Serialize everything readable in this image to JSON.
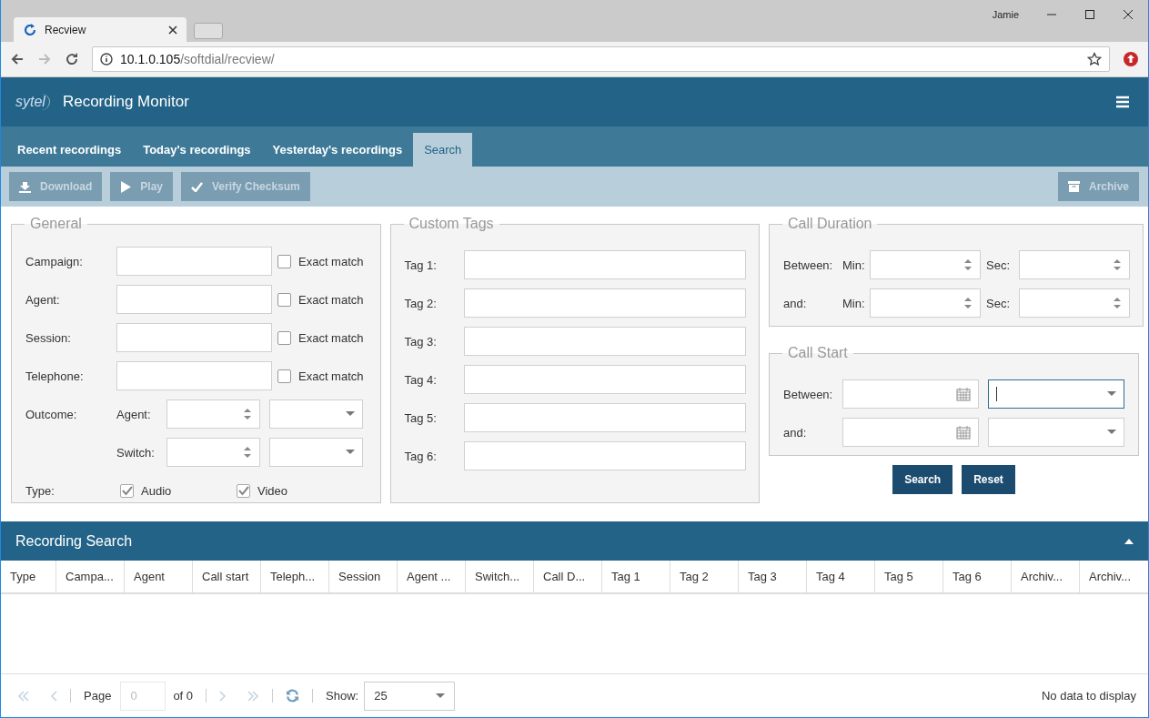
{
  "browser": {
    "tab_title": "Recview",
    "user": "Jamie",
    "url_host": "10.1.0.105",
    "url_path": "/softdial/recview/"
  },
  "header": {
    "logo": "sytel",
    "title": "Recording Monitor"
  },
  "tabs": [
    {
      "label": "Recent recordings",
      "selected": false
    },
    {
      "label": "Today's recordings",
      "selected": false
    },
    {
      "label": "Yesterday's recordings",
      "selected": false
    },
    {
      "label": "Search",
      "selected": true
    }
  ],
  "toolbar": {
    "buttons": [
      {
        "label": "Download",
        "kind": "download",
        "disabled": true
      },
      {
        "label": "Play",
        "kind": "play",
        "disabled": true
      },
      {
        "label": "Verify Checksum",
        "kind": "check",
        "disabled": true
      }
    ],
    "archive": {
      "label": "Archive",
      "disabled": true
    }
  },
  "general": {
    "title": "General",
    "fields": [
      {
        "label": "Campaign:",
        "exact_label": "Exact match",
        "exact_checked": false
      },
      {
        "label": "Agent:",
        "exact_label": "Exact match",
        "exact_checked": false
      },
      {
        "label": "Session:",
        "exact_label": "Exact match",
        "exact_checked": false
      },
      {
        "label": "Telephone:",
        "exact_label": "Exact match",
        "exact_checked": false
      }
    ],
    "outcome": {
      "label": "Outcome:",
      "rows": [
        {
          "label": "Agent:"
        },
        {
          "label": "Switch:"
        }
      ]
    },
    "type": {
      "label": "Type:",
      "options": [
        {
          "label": "Audio",
          "checked": true
        },
        {
          "label": "Video",
          "checked": true
        }
      ]
    }
  },
  "custom_tags": {
    "title": "Custom Tags",
    "tags": [
      {
        "label": "Tag 1:"
      },
      {
        "label": "Tag 2:"
      },
      {
        "label": "Tag 3:"
      },
      {
        "label": "Tag 4:"
      },
      {
        "label": "Tag 5:"
      },
      {
        "label": "Tag 6:"
      }
    ]
  },
  "call_duration": {
    "title": "Call Duration",
    "rows": [
      {
        "label": "Between:",
        "min_label": "Min:",
        "sec_label": "Sec:"
      },
      {
        "label": "and:",
        "min_label": "Min:",
        "sec_label": "Sec:"
      }
    ]
  },
  "call_start": {
    "title": "Call Start",
    "rows": [
      {
        "label": "Between:",
        "time_focused": true
      },
      {
        "label": "and:",
        "time_focused": false
      }
    ]
  },
  "form_buttons": [
    {
      "label": "Search"
    },
    {
      "label": "Reset"
    }
  ],
  "results": {
    "title": "Recording Search",
    "expanded": true,
    "columns": [
      "Type",
      "Campa...",
      "Agent",
      "Call start",
      "Teleph...",
      "Session",
      "Agent ...",
      "Switch...",
      "Call D...",
      "Tag 1",
      "Tag 2",
      "Tag 3",
      "Tag 4",
      "Tag 5",
      "Tag 6",
      "Archiv...",
      "Archiv..."
    ]
  },
  "pager": {
    "page_label": "Page",
    "page_value": "0",
    "of_label": "of 0",
    "show_label": "Show:",
    "show_value": "25",
    "status": "No data to display"
  }
}
